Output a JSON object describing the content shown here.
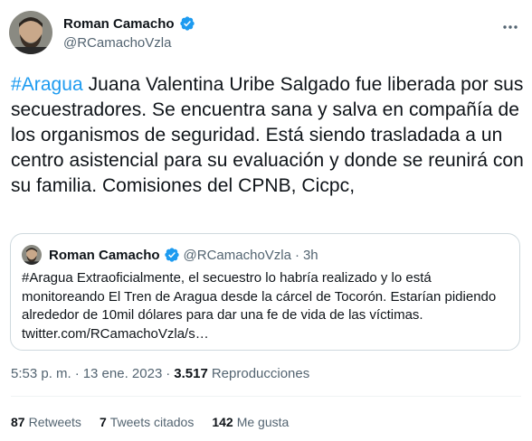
{
  "author": {
    "name": "Roman Camacho",
    "handle": "@RCamachoVzla"
  },
  "tweet": {
    "hashtag": "#Aragua",
    "text": " Juana Valentina Uribe Salgado fue liberada por sus secuestradores. Se encuentra sana y salva en compañía de los organismos de seguridad. Está siendo trasladada a un centro asistencial para su evaluación y donde se reunirá con su familia. Comisiones del CPNB, Cicpc,"
  },
  "quoted": {
    "name": "Roman Camacho",
    "handle": "@RCamachoVzla",
    "separator": "·",
    "time": "3h",
    "hashtag": "#Aragua",
    "text": " Extraoficialmente, el secuestro lo habría realizado y lo está monitoreando El Tren de Aragua desde la cárcel de Tocorón. Estarían pidiendo alrededor de 10mil dólares para dar una fe de vida de las víctimas. twitter.com/RCamachoVzla/s…"
  },
  "meta": {
    "time": "5:53 p. m.",
    "separator": "·",
    "date": "13 ene. 2023",
    "separator2": "·",
    "views_count": "3.517",
    "views_label": "Reproducciones"
  },
  "stats": {
    "retweets_count": "87",
    "retweets_label": "Retweets",
    "quotes_count": "7",
    "quotes_label": "Tweets citados",
    "likes_count": "142",
    "likes_label": "Me gusta"
  },
  "colors": {
    "accent": "#1d9bf0",
    "text": "#0f1419",
    "secondary": "#536471",
    "border": "#cfd9de"
  },
  "icons": [
    "avatar",
    "verified-icon",
    "more-icon"
  ]
}
